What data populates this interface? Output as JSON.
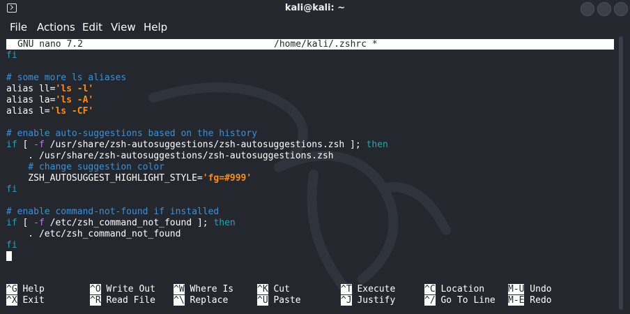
{
  "window": {
    "title": "kali@kali: ~"
  },
  "menu": [
    "File",
    "Actions",
    "Edit",
    "View",
    "Help"
  ],
  "nano": {
    "version": "GNU nano 7.2",
    "file": "/home/kali/.zshrc *"
  },
  "editor": {
    "lines": [
      [
        {
          "t": "fi",
          "c": "fi"
        }
      ],
      [],
      [
        {
          "t": "# some more ls aliases",
          "c": "comment"
        }
      ],
      [
        {
          "t": "alias ll=",
          "c": ""
        },
        {
          "t": "'ls -l'",
          "c": "str"
        }
      ],
      [
        {
          "t": "alias la=",
          "c": ""
        },
        {
          "t": "'ls -A'",
          "c": "str"
        }
      ],
      [
        {
          "t": "alias l=",
          "c": ""
        },
        {
          "t": "'ls -CF'",
          "c": "str"
        }
      ],
      [],
      [
        {
          "t": "# enable auto-suggestions based on the history",
          "c": "comment"
        }
      ],
      [
        {
          "t": "if",
          "c": "kw"
        },
        {
          "t": " [ ",
          "c": ""
        },
        {
          "t": "-f",
          "c": "flag"
        },
        {
          "t": " /usr/share/zsh-autosuggestions/zsh-autosuggestions.zsh ]; ",
          "c": ""
        },
        {
          "t": "then",
          "c": "kw"
        }
      ],
      [
        {
          "t": "    . /usr/share/zsh-autosuggestions/zsh-autosuggestions.zsh",
          "c": ""
        }
      ],
      [
        {
          "t": "    # change suggestion color",
          "c": "comment"
        }
      ],
      [
        {
          "t": "    ZSH_AUTOSUGGEST_HIGHLIGHT_STYLE=",
          "c": ""
        },
        {
          "t": "'fg=#999'",
          "c": "str"
        }
      ],
      [
        {
          "t": "fi",
          "c": "fi"
        }
      ],
      [],
      [
        {
          "t": "# enable command-not-found if installed",
          "c": "comment"
        }
      ],
      [
        {
          "t": "if",
          "c": "kw"
        },
        {
          "t": " [ ",
          "c": ""
        },
        {
          "t": "-f",
          "c": "flag"
        },
        {
          "t": " /etc/zsh_command_not_found ]; ",
          "c": ""
        },
        {
          "t": "then",
          "c": "kw"
        }
      ],
      [
        {
          "t": "    . /etc/zsh_command_not_found",
          "c": ""
        }
      ],
      [
        {
          "t": "fi",
          "c": "fi"
        }
      ]
    ]
  },
  "shortcuts": [
    [
      {
        "k": "^G",
        "l": "Help"
      },
      {
        "k": "^X",
        "l": "Exit"
      }
    ],
    [
      {
        "k": "^O",
        "l": "Write Out"
      },
      {
        "k": "^R",
        "l": "Read File"
      }
    ],
    [
      {
        "k": "^W",
        "l": "Where Is"
      },
      {
        "k": "^\\",
        "l": "Replace"
      }
    ],
    [
      {
        "k": "^K",
        "l": "Cut"
      },
      {
        "k": "^U",
        "l": "Paste"
      }
    ],
    [
      {
        "k": "^T",
        "l": "Execute"
      },
      {
        "k": "^J",
        "l": "Justify"
      }
    ],
    [
      {
        "k": "^C",
        "l": "Location"
      },
      {
        "k": "^/",
        "l": "Go To Line"
      }
    ],
    [
      {
        "k": "M-U",
        "l": "Undo"
      },
      {
        "k": "M-E",
        "l": "Redo"
      }
    ]
  ]
}
